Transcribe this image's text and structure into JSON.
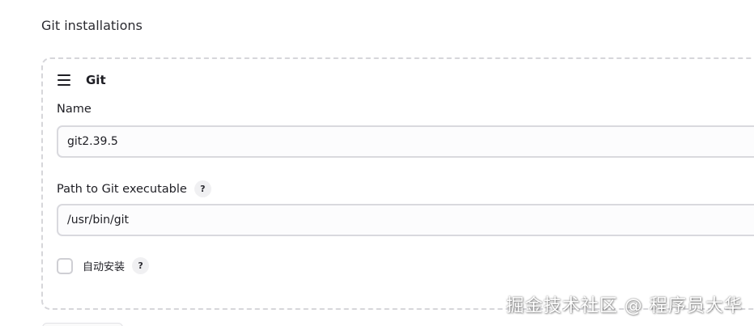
{
  "section": {
    "title": "Git installations"
  },
  "installation": {
    "title": "Git",
    "drag_icon": "drag-handle-icon",
    "name_field": {
      "label": "Name",
      "value": "git2.39.5"
    },
    "path_field": {
      "label": "Path to Git executable",
      "help": "?",
      "value": "/usr/bin/git"
    },
    "auto_install": {
      "label": "自动安装",
      "help": "?",
      "checked": false
    }
  },
  "watermark": "掘金技术社区 @ 程序员大华",
  "colors": {
    "border_dashed": "#d6d6da",
    "input_border": "#d9d9de",
    "help_bg": "#f0f0f2",
    "text": "#1e1e24"
  }
}
